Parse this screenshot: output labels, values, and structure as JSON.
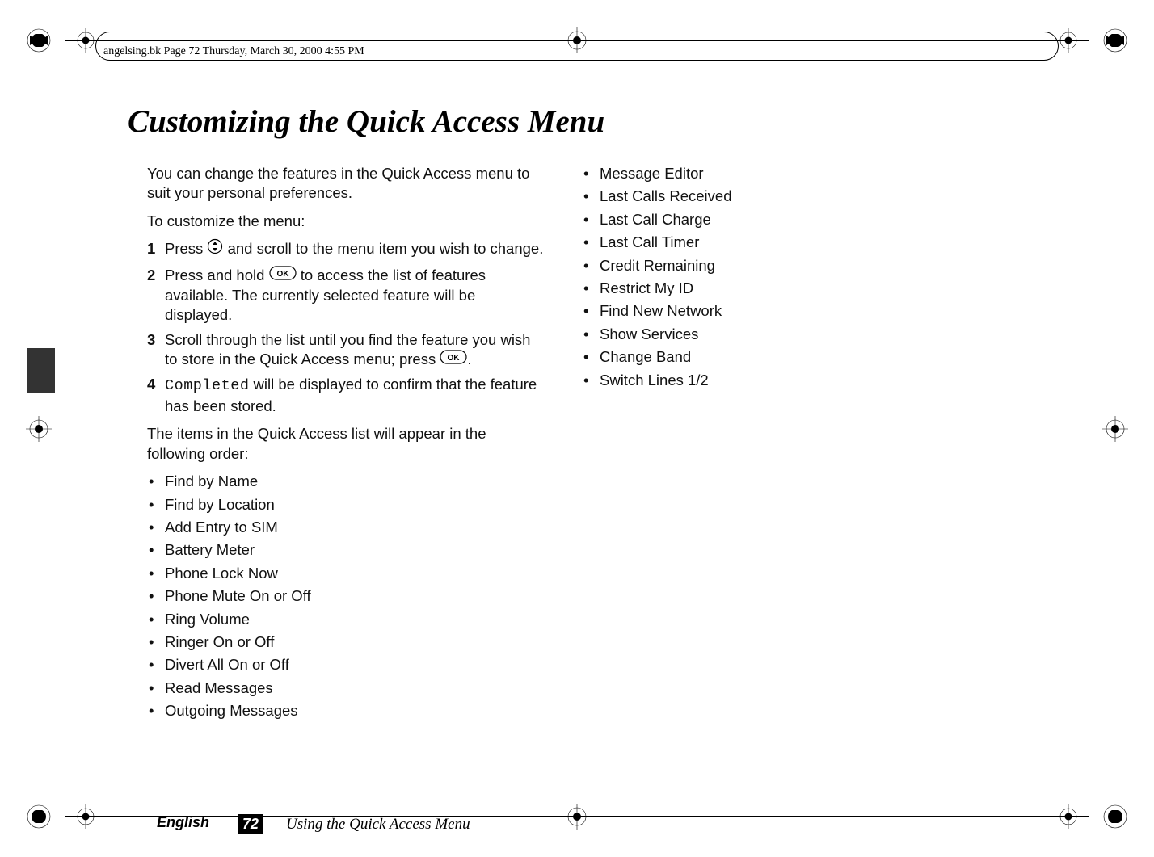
{
  "header_filename": "angelsing.bk  Page 72  Thursday, March 30, 2000  4:55 PM",
  "title": "Customizing the Quick Access Menu",
  "intro_para": "You can change the features in the Quick Access menu to suit your personal preferences.",
  "customize_lead": "To customize the menu:",
  "steps": {
    "s1_pre": "Press ",
    "s1_post": " and scroll to the menu item you wish to change.",
    "s2_pre": "Press and hold ",
    "s2_post": " to access the list of features available. The currently selected feature will be displayed.",
    "s3_pre": "Scroll through the list until you find the feature you wish to store in the Quick Access menu; press ",
    "s3_post": ".",
    "s4_code": "Completed",
    "s4_post": " will be displayed to confirm that the feature has been stored."
  },
  "order_intro": "The items in the Quick Access list will appear in the following order:",
  "col1_items": [
    "Find by Name",
    "Find by Location",
    "Add Entry to SIM",
    "Battery Meter",
    "Phone Lock Now",
    "Phone Mute On or Off",
    "Ring Volume",
    "Ringer On or Off",
    "Divert All On or Off",
    "Read Messages",
    "Outgoing Messages"
  ],
  "col2_items": [
    "Message Editor",
    "Last Calls Received",
    "Last Call Charge",
    "Last Call Timer",
    "Credit Remaining",
    "Restrict My ID",
    "Find New Network",
    "Show Services",
    "Change Band",
    "Switch Lines 1/2"
  ],
  "footer": {
    "language": "English",
    "page_number": "72",
    "section": "Using the Quick Access Menu"
  }
}
